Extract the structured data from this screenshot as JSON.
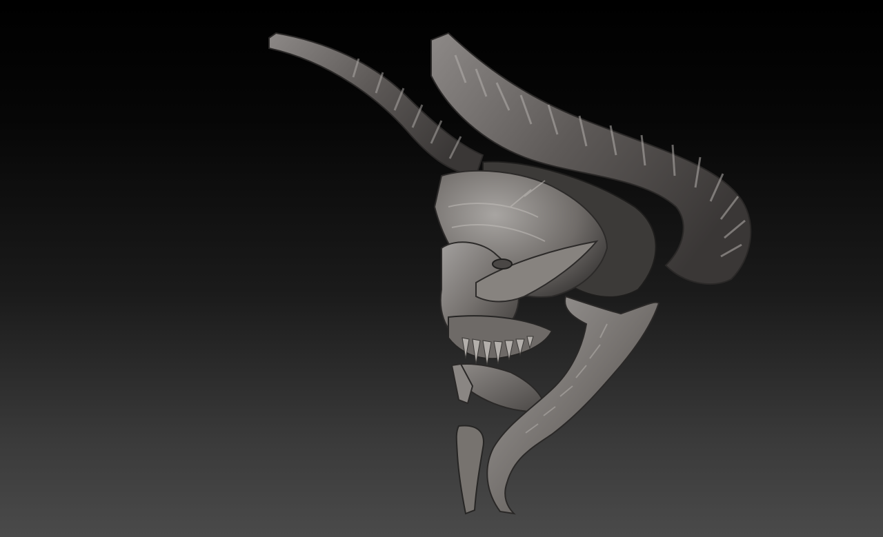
{
  "scene": {
    "subject": "sculpt-icon",
    "colors": {
      "background_top": "#000000",
      "background_bottom": "#4a4a4a",
      "clay_light": "#9a9795",
      "clay_mid": "#6f6c6a",
      "clay_dark": "#3a3837",
      "clay_shadow": "#1e1d1c"
    }
  }
}
